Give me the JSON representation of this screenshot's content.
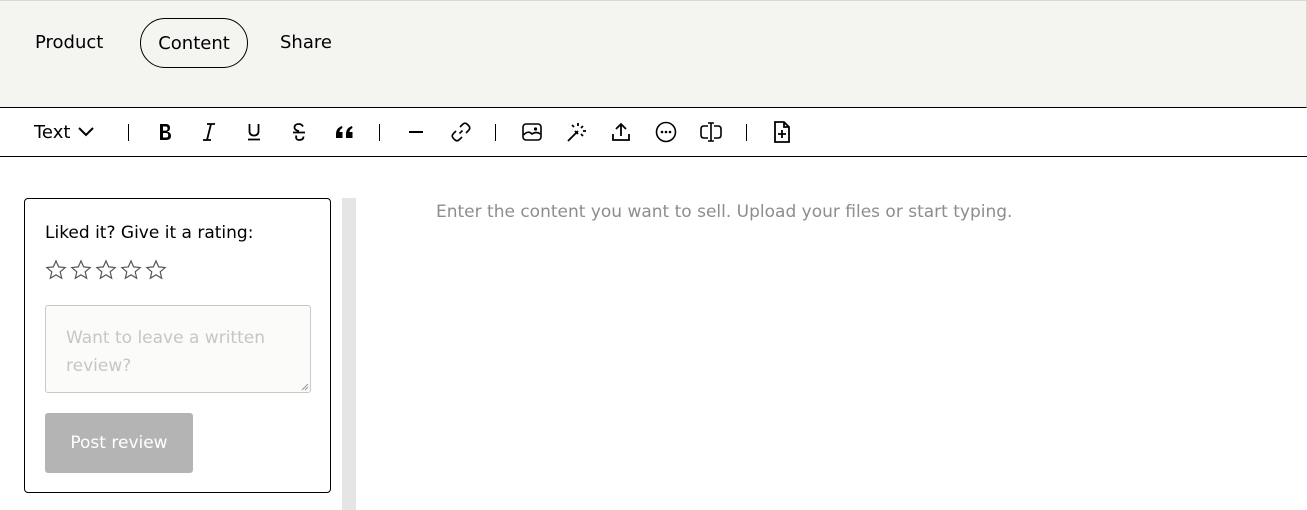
{
  "tabs": [
    {
      "label": "Product",
      "active": false
    },
    {
      "label": "Content",
      "active": true
    },
    {
      "label": "Share",
      "active": false
    }
  ],
  "toolbar": {
    "text_style_label": "Text",
    "icons": [
      "bold-icon",
      "italic-icon",
      "underline-icon",
      "strikethrough-icon",
      "quote-icon",
      "horizontal-rule-icon",
      "link-icon",
      "image-icon",
      "magic-icon",
      "upload-icon",
      "more-icon",
      "text-cursor-icon",
      "file-add-icon"
    ]
  },
  "review": {
    "title": "Liked it? Give it a rating:",
    "rating": 0,
    "max_rating": 5,
    "input_placeholder": "Want to leave a written review?",
    "post_label": "Post review"
  },
  "editor": {
    "placeholder": "Enter the content you want to sell. Upload your files or start typing."
  },
  "colors": {
    "topbar_bg": "#f4f4f0",
    "button_disabled": "#b4b4b4",
    "placeholder_text": "#8d8d8d"
  }
}
